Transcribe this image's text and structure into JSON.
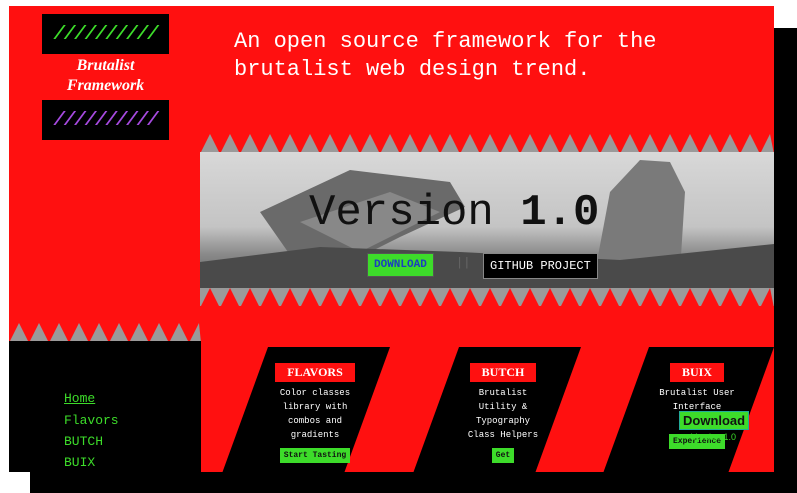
{
  "logo": {
    "stripes_top": "//////////",
    "stripes_bottom": "//////////",
    "name_line1": "Brutalist",
    "name_line2": "Framework"
  },
  "tagline": {
    "line1": "An open source framework for the",
    "line2": "brutalist web design trend."
  },
  "hero": {
    "version_label": "Version",
    "version_number": "1.0",
    "download_label": "DOWNLOAD",
    "separator": "||",
    "github_label": "GITHUB PROJECT"
  },
  "nav": {
    "items": [
      "Home",
      "Flavors",
      "BUTCH",
      "BUIX"
    ]
  },
  "cards": [
    {
      "title": "FLAVORS",
      "desc_lines": [
        "Color classes",
        "library with",
        "combos and",
        "gradients"
      ],
      "cta": "Start Tasting"
    },
    {
      "title": "BUTCH",
      "desc_lines": [
        "Brutalist",
        "Utility &",
        "Typography",
        "Class Helpers"
      ],
      "cta": "Get"
    },
    {
      "title": "BUIX",
      "desc_lines": [
        "Brutalist User",
        "Interface",
        "Expe"
      ],
      "cta": "Experience"
    }
  ],
  "badge": {
    "label": "Download",
    "sub": "Version 1.0"
  },
  "colors": {
    "red": "#ff1010",
    "green": "#3ddc2a",
    "black": "#000000",
    "purple": "#a64ae0",
    "blue": "#1b3fbf"
  }
}
